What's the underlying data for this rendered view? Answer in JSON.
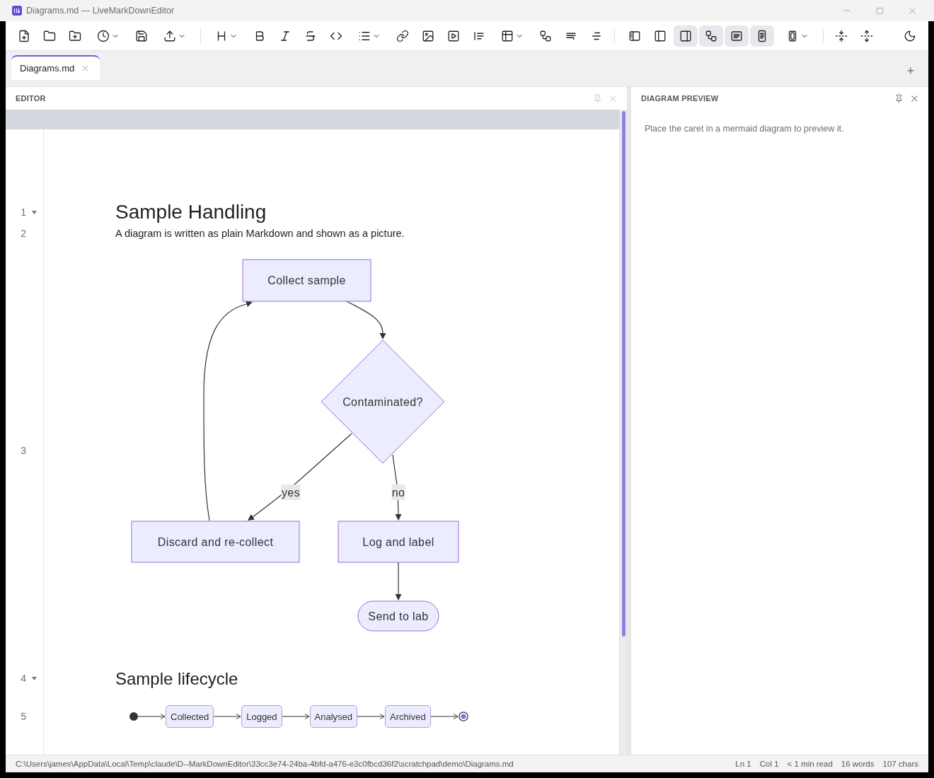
{
  "window": {
    "title": "Diagrams.md — LiveMarkDownEditor"
  },
  "toolbar": {
    "view_buttons": [
      {
        "pressed": false
      },
      {
        "pressed": false
      },
      {
        "pressed": true
      },
      {
        "pressed": true
      },
      {
        "pressed": true
      },
      {
        "pressed": true
      }
    ]
  },
  "tabs": [
    {
      "label": "Diagrams.md",
      "selected": true
    }
  ],
  "editor": {
    "title": "EDITOR",
    "focused": false,
    "lines": [
      {
        "number": "1",
        "foldable": true,
        "kind": "h1",
        "text": "Sample Handling"
      },
      {
        "number": "2",
        "foldable": false,
        "kind": "paragraph",
        "text": "A diagram is written as plain Markdown and shown as a picture."
      },
      {
        "number": "3",
        "foldable": false,
        "kind": "flowchart",
        "nodes": [
          {
            "kind": "process",
            "label": "Collect sample"
          },
          {
            "kind": "decision",
            "label": "Contaminated?"
          },
          {
            "kind": "process",
            "label": "Discard and re-collect"
          },
          {
            "kind": "process",
            "label": "Log and label"
          },
          {
            "kind": "terminal",
            "label": "Send to lab"
          }
        ],
        "edge_labels": [
          "yes",
          "no"
        ]
      },
      {
        "number": "4",
        "foldable": true,
        "kind": "h2",
        "text": "Sample lifecycle"
      },
      {
        "number": "5",
        "foldable": false,
        "kind": "state_diagram",
        "states": [
          "Collected",
          "Logged",
          "Analysed",
          "Archived"
        ]
      }
    ]
  },
  "preview": {
    "title": "DIAGRAM PREVIEW",
    "focused": true,
    "message": "Place the caret in a mermaid diagram to preview it."
  },
  "status_bar": {
    "path": "C:\\Users\\james\\AppData\\Local\\Temp\\claude\\D--MarkDownEditor\\33cc3e74-24ba-4bfd-a476-e3c0fbcd36f2\\scratchpad\\demo\\Diagrams.md",
    "items": [
      "Ln 1",
      "Col 1",
      "< 1 min read",
      "16 words",
      "107 chars"
    ]
  }
}
